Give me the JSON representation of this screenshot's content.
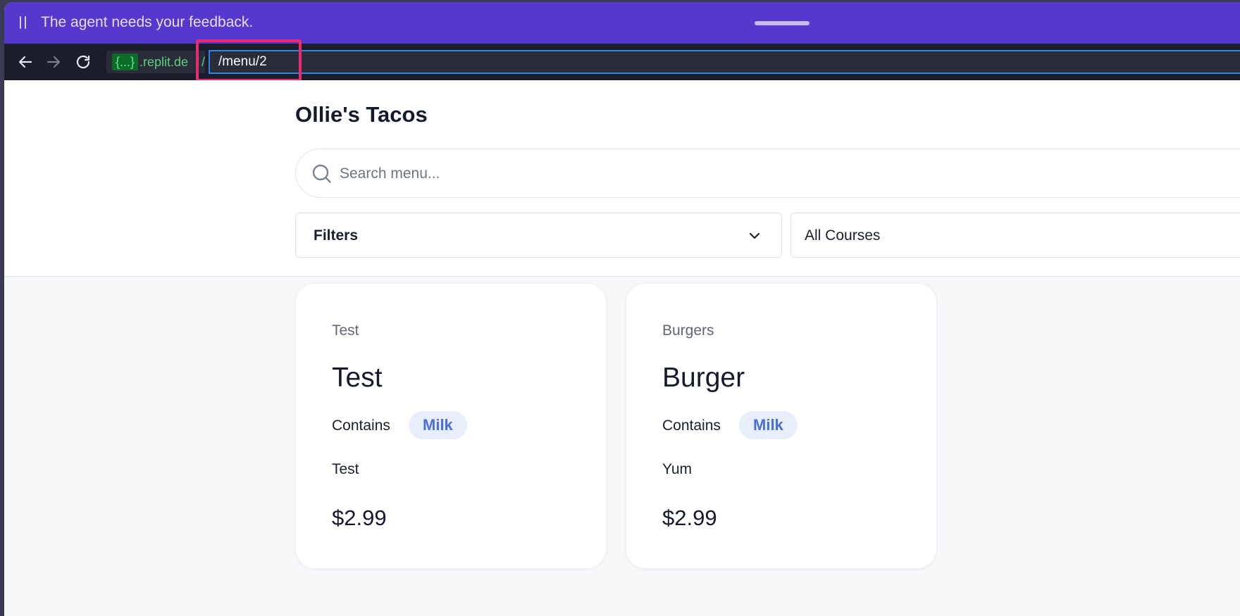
{
  "banner": {
    "message": "The agent needs your feedback."
  },
  "urlbar": {
    "host_badge": "{...}",
    "host_suffix": ".replit.de",
    "host_separator": "/",
    "path_value": "/menu/2",
    "highlight_color": "#ec2a6f"
  },
  "page": {
    "title": "Ollie's Tacos",
    "search": {
      "placeholder": "Search menu..."
    },
    "filters": {
      "label": "Filters"
    },
    "courses": {
      "label": "All Courses"
    }
  },
  "menu_items": [
    {
      "category": "Test",
      "name": "Test",
      "contains_label": "Contains",
      "allergen": "Milk",
      "description": "Test",
      "price": "$2.99"
    },
    {
      "category": "Burgers",
      "name": "Burger",
      "contains_label": "Contains",
      "allergen": "Milk",
      "description": "Yum",
      "price": "$2.99"
    }
  ],
  "colors": {
    "banner": "#5538cc",
    "urlbar": "#1c1d2b",
    "accent": "#4a6ee0"
  }
}
